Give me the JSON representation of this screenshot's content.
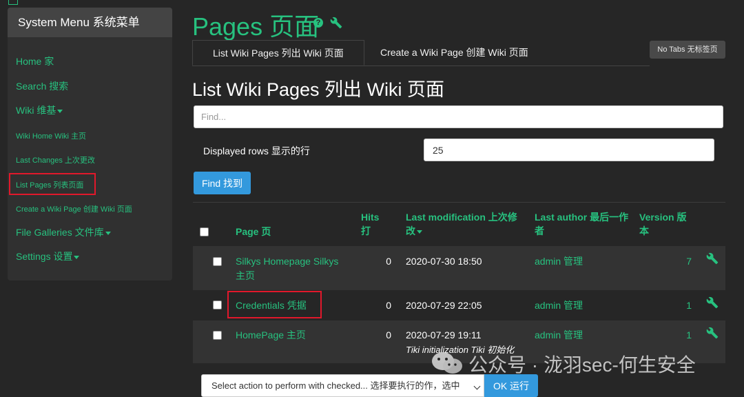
{
  "sidebar": {
    "title": "System Menu 系统菜单",
    "items": [
      {
        "label": "Home 家",
        "has_caret": false
      },
      {
        "label": "Search 搜索",
        "has_caret": false
      },
      {
        "label": "Wiki 维基",
        "has_caret": true
      },
      {
        "label": "Wiki Home Wiki 主页",
        "has_caret": false
      },
      {
        "label": "Last Changes 上次更改",
        "has_caret": false
      },
      {
        "label": "List Pages 列表页面",
        "has_caret": false
      },
      {
        "label": "Create a Wiki Page 创建 Wiki 页面",
        "has_caret": false
      },
      {
        "label": "File Galleries 文件库",
        "has_caret": true
      },
      {
        "label": "Settings 设置",
        "has_caret": true
      }
    ]
  },
  "header": {
    "title": "Pages 页面",
    "help_icon_glyph": "?"
  },
  "tabs": [
    {
      "label": "List Wiki Pages 列出 Wiki 页面",
      "active": true
    },
    {
      "label": "Create a Wiki Page 创建 Wiki 页面",
      "active": false
    }
  ],
  "no_tabs_label": "No Tabs 无标签页",
  "section_title": "List Wiki Pages 列出 Wiki 页面",
  "search": {
    "placeholder": "Find...",
    "rows_label": "Displayed rows 显示的行",
    "rows_value": "25",
    "find_label": "Find 找到"
  },
  "table": {
    "headers": {
      "page": "Page 页",
      "hits_line1": "Hits",
      "hits_line2": "打",
      "lastmod_line1": "Last modification 上次修",
      "lastmod_line2": "改",
      "author_line1": "Last author 最后一作",
      "author_line2": "者",
      "version_line1": "Version 版",
      "version_line2": "本"
    },
    "rows": [
      {
        "page_line1": "Silkys Homepage Silkys",
        "page_line2": "主页",
        "hits": "0",
        "lastmod": "2020-07-30 18:50",
        "description": "",
        "author": "admin 管理",
        "version": "7"
      },
      {
        "page_line1": "Credentials 凭据",
        "page_line2": "",
        "hits": "0",
        "lastmod": "2020-07-29 22:05",
        "description": "",
        "author": "admin 管理",
        "version": "1"
      },
      {
        "page_line1": "HomePage 主页",
        "page_line2": "",
        "hits": "0",
        "lastmod": "2020-07-29 19:11",
        "description": "Tiki initialization Tiki 初始化",
        "author": "admin 管理",
        "version": "1"
      }
    ]
  },
  "actions": {
    "select_value": "Select action to perform with checked... 选择要执行的作，选中",
    "ok_label": "OK 运行"
  },
  "watermark": {
    "text": "公众号 · 泷羽sec-何生安全"
  },
  "colors": {
    "accent": "#27c17f",
    "button_blue": "#3399dd",
    "highlight_red": "#e2182b",
    "background": "#262626"
  }
}
